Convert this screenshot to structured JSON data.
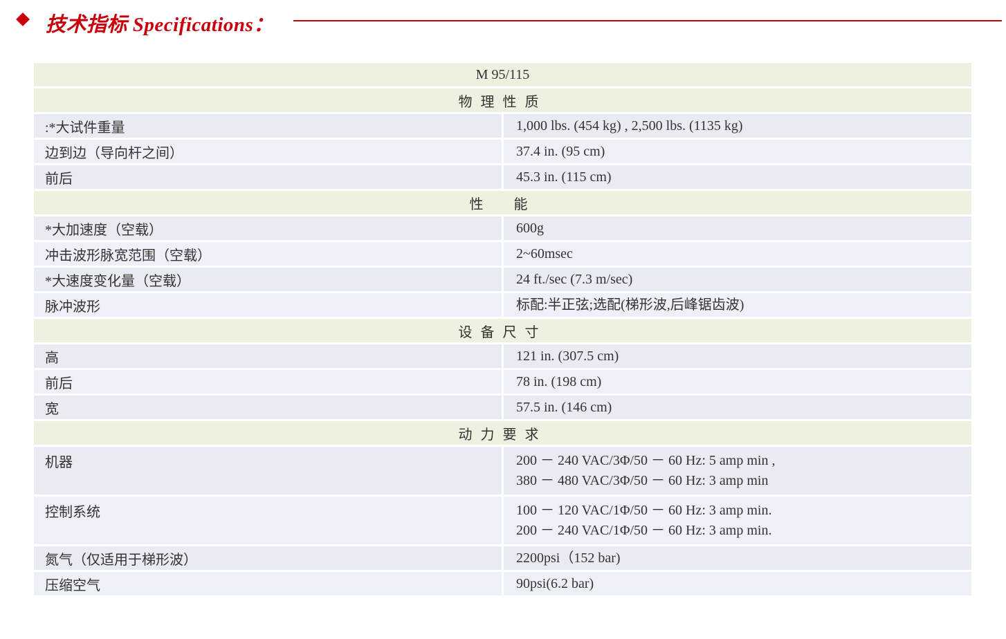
{
  "header": {
    "title": "技术指标 Specifications："
  },
  "table": {
    "model": "M 95/115",
    "sections": [
      {
        "title": "物理性质",
        "rows": [
          {
            "label": ":*大试件重量",
            "value": [
              "1,000 lbs. (454 kg) , 2,500 lbs. (1135 kg)"
            ]
          },
          {
            "label": "边到边（导向杆之间）",
            "value": [
              "37.4 in. (95 cm)"
            ]
          },
          {
            "label": "前后",
            "value": [
              "45.3 in. (115 cm)"
            ]
          }
        ]
      },
      {
        "title": "性　能",
        "rows": [
          {
            "label": "*大加速度（空载）",
            "value": [
              "600g"
            ]
          },
          {
            "label": "冲击波形脉宽范围（空载）",
            "value": [
              "2~60msec"
            ]
          },
          {
            "label": "*大速度变化量（空载）",
            "value": [
              "24 ft./sec (7.3 m/sec)"
            ]
          },
          {
            "label": "脉冲波形",
            "value": [
              "标配:半正弦;选配(梯形波,后峰锯齿波)"
            ]
          }
        ]
      },
      {
        "title": "设备尺寸",
        "rows": [
          {
            "label": "高",
            "value": [
              "121 in. (307.5 cm)"
            ]
          },
          {
            "label": "前后",
            "value": [
              "78 in. (198 cm)"
            ]
          },
          {
            "label": "宽",
            "value": [
              "57.5 in. (146 cm)"
            ]
          }
        ]
      },
      {
        "title": "动力要求",
        "rows": [
          {
            "label": "机器",
            "value": [
              "200 － 240 VAC/3Φ/50 － 60 Hz: 5 amp min ,",
              "380 － 480 VAC/3Φ/50 － 60 Hz: 3 amp min"
            ]
          },
          {
            "label": "控制系统",
            "value": [
              "100 － 120 VAC/1Φ/50 － 60 Hz: 3 amp min.",
              "200 － 240 VAC/1Φ/50 － 60 Hz: 3 amp min."
            ]
          },
          {
            "label": "氮气（仅适用于梯形波）",
            "value": [
              "2200psi（152 bar)"
            ]
          },
          {
            "label": "压缩空气",
            "value": [
              "90psi(6.2 bar)"
            ]
          }
        ]
      }
    ]
  },
  "colors": {
    "accent": "#c8000c",
    "section_bg": "#eef0e0",
    "row_bg": "#e9ebf3"
  }
}
